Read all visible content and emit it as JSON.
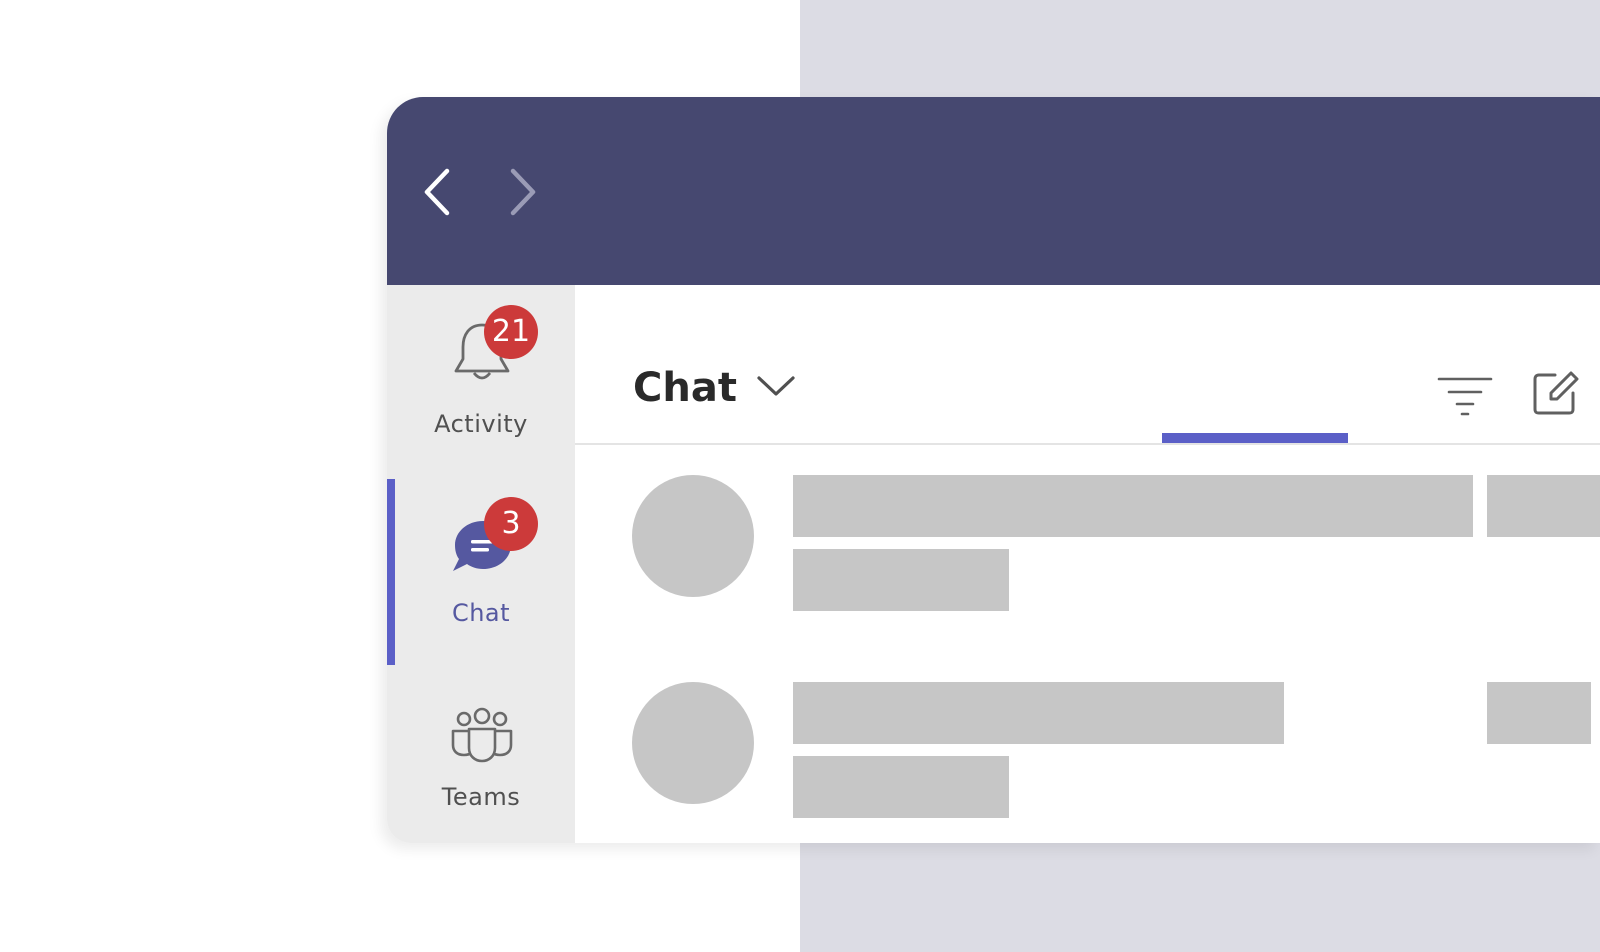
{
  "colors": {
    "titlebar": "#464870",
    "accent": "#5b5fc7",
    "badge": "#cc3a3a",
    "rail": "#ebebeb",
    "placeholder": "#c6c6c6",
    "page_bg_right": "#dcdce4"
  },
  "titlebar": {
    "back_icon": "chevron-left-icon",
    "forward_icon": "chevron-right-icon"
  },
  "rail": {
    "items": [
      {
        "label": "Activity",
        "icon": "bell-icon",
        "badge": "21",
        "active": false
      },
      {
        "label": "Chat",
        "icon": "chat-bubble-icon",
        "badge": "3",
        "active": true
      },
      {
        "label": "Teams",
        "icon": "teams-icon",
        "active": false
      }
    ]
  },
  "chat_header": {
    "title": "Chat",
    "dropdown_icon": "chevron-down-icon",
    "filter_icon": "filter-icon",
    "compose_icon": "compose-icon"
  }
}
